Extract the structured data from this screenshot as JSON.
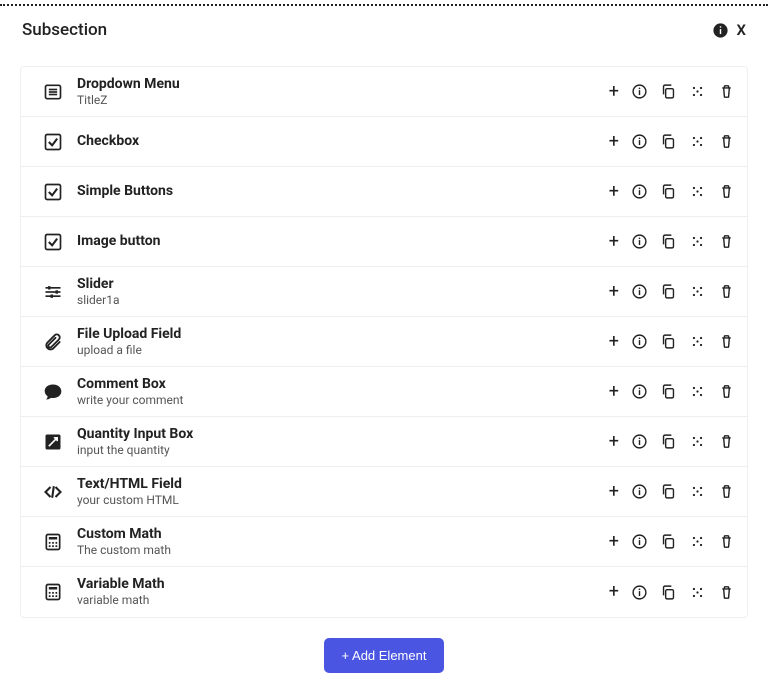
{
  "header": {
    "title": "Subsection",
    "close": "X"
  },
  "rows": [
    {
      "icon": "list",
      "title": "Dropdown Menu",
      "sub": "TitleZ"
    },
    {
      "icon": "check",
      "title": "Checkbox",
      "sub": ""
    },
    {
      "icon": "check",
      "title": "Simple Buttons",
      "sub": ""
    },
    {
      "icon": "check",
      "title": "Image button",
      "sub": ""
    },
    {
      "icon": "sliders",
      "title": "Slider",
      "sub": "slider1a"
    },
    {
      "icon": "clip",
      "title": "File Upload Field",
      "sub": "upload a file"
    },
    {
      "icon": "comment",
      "title": "Comment Box",
      "sub": "write your comment"
    },
    {
      "icon": "expo",
      "title": "Quantity Input Box",
      "sub": "input the quantity"
    },
    {
      "icon": "code",
      "title": "Text/HTML Field",
      "sub": "your custom HTML"
    },
    {
      "icon": "calc",
      "title": "Custom Math",
      "sub": "The custom math"
    },
    {
      "icon": "calc",
      "title": "Variable Math",
      "sub": "variable math"
    }
  ],
  "footer": {
    "add_label": "+ Add Element"
  }
}
